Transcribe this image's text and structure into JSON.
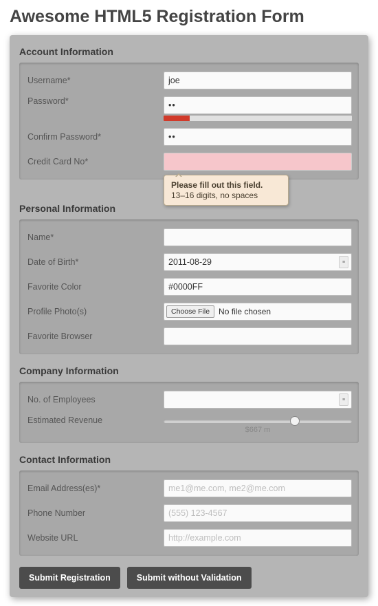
{
  "title": "Awesome HTML5 Registration Form",
  "account": {
    "title": "Account Information",
    "username_label": "Username*",
    "username_value": "joe",
    "password_label": "Password*",
    "password_value": "••",
    "confirm_label": "Confirm Password*",
    "confirm_value": "••",
    "cc_label": "Credit Card No*",
    "cc_value": "",
    "tooltip_title": "Please fill out this field.",
    "tooltip_hint": "13–16 digits, no spaces"
  },
  "personal": {
    "title": "Personal Information",
    "name_label": "Name*",
    "name_value": "",
    "dob_label": "Date of Birth*",
    "dob_value": "2011-08-29",
    "color_label": "Favorite Color",
    "color_value": "#0000FF",
    "photo_label": "Profile Photo(s)",
    "choose_label": "Choose File",
    "file_status": "No file chosen",
    "browser_label": "Favorite Browser",
    "browser_value": ""
  },
  "company": {
    "title": "Company Information",
    "employees_label": "No. of Employees",
    "employees_value": "",
    "revenue_label": "Estimated Revenue",
    "revenue_display": "$667 m"
  },
  "contact": {
    "title": "Contact Information",
    "email_label": "Email Address(es)*",
    "email_placeholder": "me1@me.com, me2@me.com",
    "phone_label": "Phone Number",
    "phone_placeholder": "(555) 123-4567",
    "url_label": "Website URL",
    "url_placeholder": "http://example.com"
  },
  "buttons": {
    "submit": "Submit Registration",
    "submit_novalidate": "Submit without Validation"
  }
}
